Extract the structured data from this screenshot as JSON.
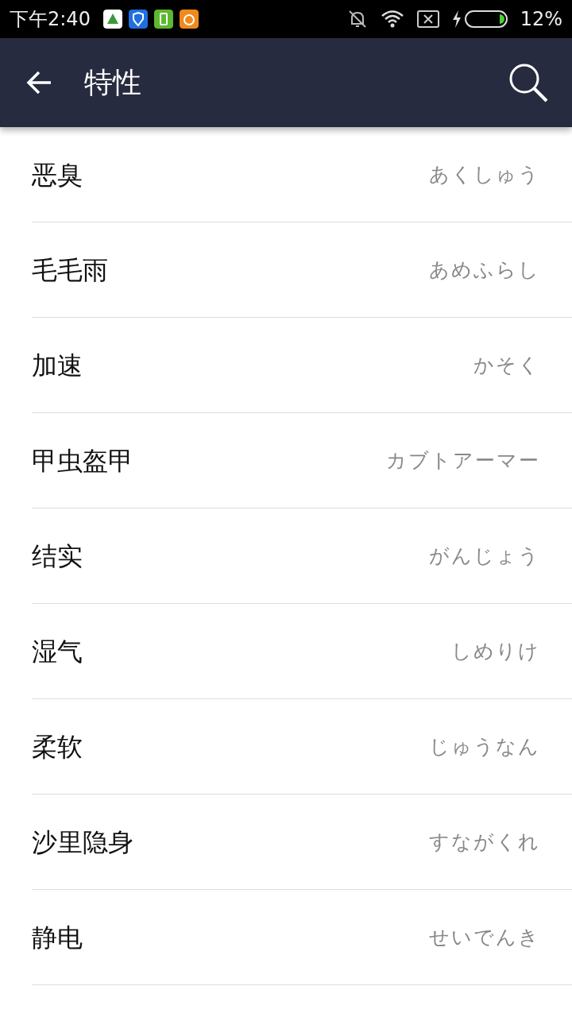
{
  "status_bar": {
    "time": "下午2:40",
    "battery": "12%"
  },
  "app_bar": {
    "title": "特性"
  },
  "items": [
    {
      "name": "恶臭",
      "reading": "あくしゅう"
    },
    {
      "name": "毛毛雨",
      "reading": "あめふらし"
    },
    {
      "name": "加速",
      "reading": "かそく"
    },
    {
      "name": "甲虫盔甲",
      "reading": "カブトアーマー"
    },
    {
      "name": "结实",
      "reading": "がんじょう"
    },
    {
      "name": "湿气",
      "reading": "しめりけ"
    },
    {
      "name": "柔软",
      "reading": "じゅうなん"
    },
    {
      "name": "沙里隐身",
      "reading": "すながくれ"
    },
    {
      "name": "静电",
      "reading": "せいでんき"
    }
  ]
}
